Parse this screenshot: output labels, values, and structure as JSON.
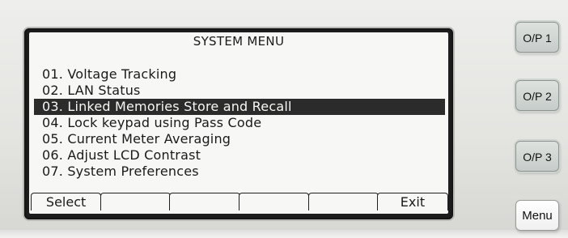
{
  "screen": {
    "title": "SYSTEM MENU",
    "items": [
      {
        "label": "01. Voltage Tracking",
        "selected": false
      },
      {
        "label": "02. LAN Status",
        "selected": false
      },
      {
        "label": "03. Linked Memories Store and Recall",
        "selected": true
      },
      {
        "label": "04. Lock keypad using Pass Code",
        "selected": false
      },
      {
        "label": "05. Current Meter Averaging",
        "selected": false
      },
      {
        "label": "06. Adjust LCD Contrast",
        "selected": false
      },
      {
        "label": "07. System Preferences",
        "selected": false
      }
    ],
    "softkeys": [
      "Select",
      "",
      "",
      "",
      "",
      "Exit"
    ]
  },
  "hardware_buttons": {
    "op1": "O/P 1",
    "op2": "O/P 2",
    "op3": "O/P 3",
    "menu": "Menu"
  },
  "colors": {
    "lcd_background": "#f7f7f5",
    "highlight": "#2b2b2b",
    "panel": "#e3e3e0",
    "op_button": "#c6ccc9"
  }
}
